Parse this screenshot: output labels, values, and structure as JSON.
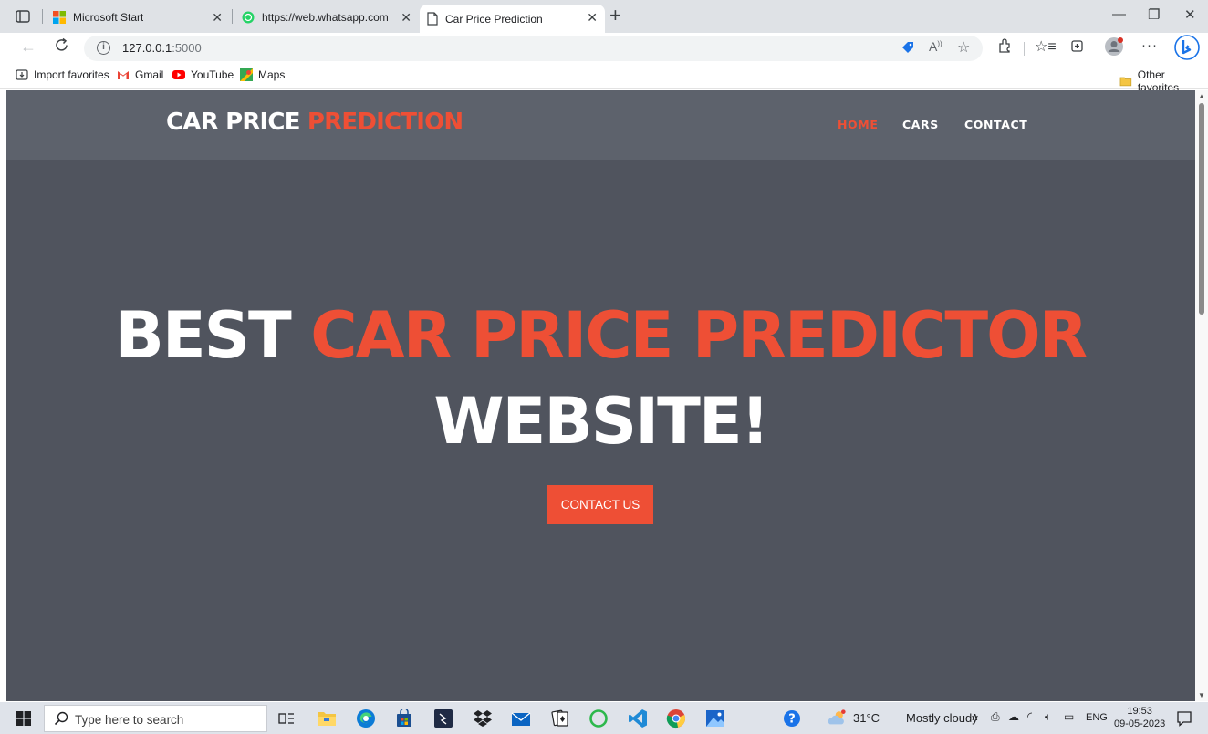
{
  "browser": {
    "tabs": [
      {
        "title": "Microsoft Start",
        "icon": "microsoft-start-icon",
        "active": false
      },
      {
        "title": "https://web.whatsapp.com",
        "icon": "whatsapp-icon",
        "active": false
      },
      {
        "title": "Car Price Prediction",
        "icon": "page-icon",
        "active": true
      }
    ],
    "address": {
      "host": "127.0.0.1",
      "port": ":5000"
    },
    "favorites": [
      {
        "label": "Import favorites",
        "icon": "import-icon"
      },
      {
        "label": "Gmail",
        "icon": "gmail-icon"
      },
      {
        "label": "YouTube",
        "icon": "youtube-icon"
      },
      {
        "label": "Maps",
        "icon": "maps-icon"
      }
    ],
    "other_favorites": "Other favorites"
  },
  "site": {
    "logo_main": "CAR PRICE ",
    "logo_accent": "PREDICTION",
    "nav": [
      {
        "label": "HOME",
        "active": true
      },
      {
        "label": "CARS",
        "active": false
      },
      {
        "label": "CONTACT",
        "active": false
      }
    ],
    "hero": {
      "line1_white": "BEST ",
      "line1_accent": "CAR PRICE PREDICTOR",
      "line2": "WEBSITE!"
    },
    "cta_label": "CONTACT US",
    "colors": {
      "accent": "#ee4f35",
      "header_bg": "#5d626c",
      "hero_bg": "#50545e"
    }
  },
  "taskbar": {
    "search_placeholder": "Type here to search",
    "weather": {
      "temp": "31°C",
      "condition": "Mostly cloudy"
    },
    "language": "ENG",
    "time": "19:53",
    "date": "09-05-2023"
  }
}
